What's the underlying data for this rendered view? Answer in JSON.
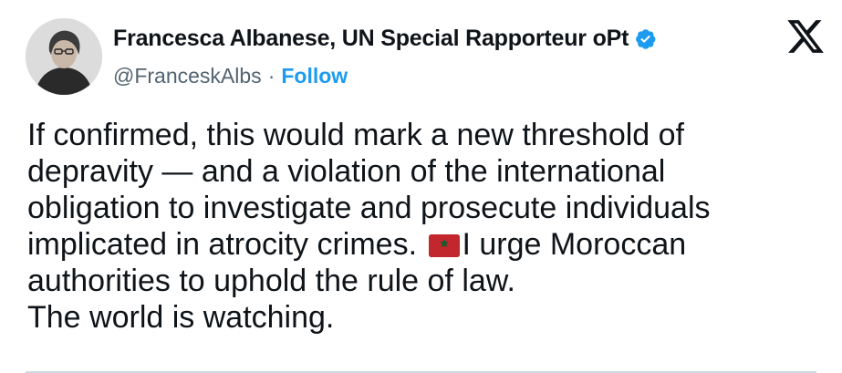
{
  "author": {
    "display_name": "Francesca Albanese, UN Special Rapporteur oPt",
    "handle": "@FranceskAlbs",
    "separator": "·",
    "follow_label": "Follow",
    "verified": true
  },
  "colors": {
    "text": "#0f1419",
    "secondary_text": "#536471",
    "accent": "#1d9bf0",
    "flag_red": "#c1272d",
    "flag_green": "#006233"
  },
  "icons": {
    "brand": "x-logo-icon",
    "verified": "verified-badge-icon",
    "flag": "morocco-flag-emoji"
  },
  "tweet": {
    "lines": [
      "If confirmed, this would mark a new threshold of",
      "depravity — and a violation of the international",
      "obligation to investigate and prosecute individuals",
      "implicated in atrocity crimes. ",
      "I urge Moroccan",
      "authorities to uphold the rule of law.",
      "The world is watching."
    ]
  }
}
